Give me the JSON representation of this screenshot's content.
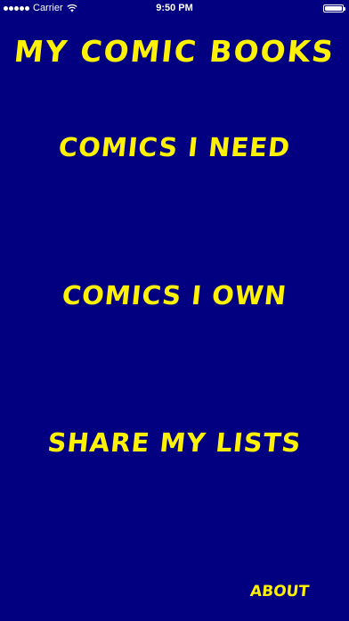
{
  "status_bar": {
    "carrier": "Carrier",
    "time": "9:50 PM",
    "battery_level": 1.0
  },
  "title": "My Comic Books",
  "menu": {
    "comics_need": "Comics I Need",
    "comics_own": "Comics I Own",
    "share_lists": "Share My Lists"
  },
  "about_label": "About",
  "colors": {
    "background": "#020080",
    "text_accent": "#FFF200",
    "status_text": "#FFFFFF"
  },
  "icons": [
    "signal-icon",
    "wifi-icon",
    "battery-icon"
  ]
}
